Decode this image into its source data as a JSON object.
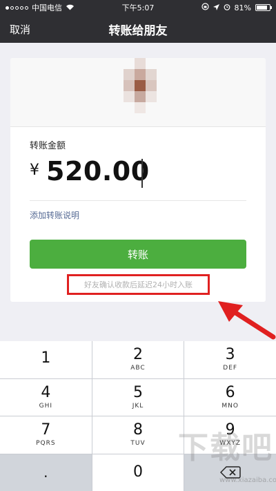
{
  "status_bar": {
    "carrier": "中国电信",
    "time": "下午5:07",
    "battery": "81%",
    "battery_level": 0.81
  },
  "nav": {
    "cancel": "取消",
    "title": "转账给朋友"
  },
  "card": {
    "amount_label": "转账金额",
    "currency": "¥",
    "amount": "520.00",
    "add_note": "添加转账说明",
    "transfer_button": "转账",
    "hint": "好友确认收款后延迟24小时入账"
  },
  "keypad": {
    "keys": [
      {
        "num": "1",
        "sub": ""
      },
      {
        "num": "2",
        "sub": "ABC"
      },
      {
        "num": "3",
        "sub": "DEF"
      },
      {
        "num": "4",
        "sub": "GHI"
      },
      {
        "num": "5",
        "sub": "JKL"
      },
      {
        "num": "6",
        "sub": "MNO"
      },
      {
        "num": "7",
        "sub": "PQRS"
      },
      {
        "num": "8",
        "sub": "TUV"
      },
      {
        "num": "9",
        "sub": "WXYZ"
      }
    ],
    "dot": ".",
    "zero": "0"
  },
  "watermark": {
    "text": "下载吧",
    "url": "www.xiazaiba.com"
  },
  "colors": {
    "nav_bg": "#2f2f33",
    "button_green": "#4cae3f",
    "highlight_red": "#e02020",
    "link_blue": "#576b95"
  }
}
